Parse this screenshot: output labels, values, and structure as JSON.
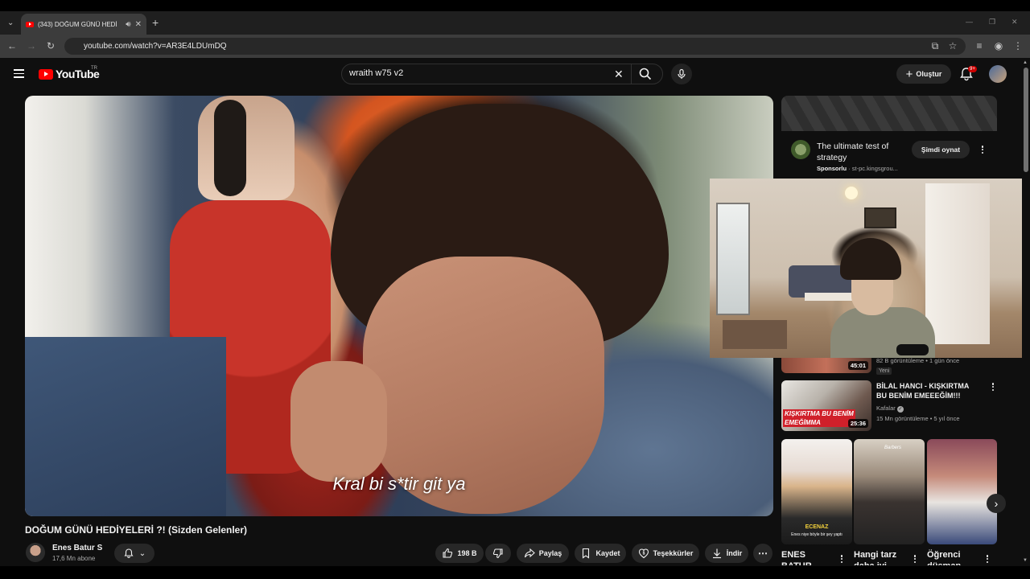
{
  "browser": {
    "tab_title": "(343) DOĞUM GÜNÜ HEDİ",
    "url": "youtube.com/watch?v=AR3E4LDUmDQ"
  },
  "header": {
    "logo_text": "YouTube",
    "country_code": "TR",
    "search_value": "wraith w75 v2",
    "create_label": "Oluştur",
    "notification_count": "9+"
  },
  "video": {
    "subtitle": "Kral bi s*tir git ya",
    "title": "DOĞUM GÜNÜ HEDİYELERİ ?! (Sizden Gelenler)",
    "channel_name": "Enes Batur S",
    "subscribers": "17,6 Mn abone",
    "likes": "198 B",
    "share_label": "Paylaş",
    "save_label": "Kaydet",
    "thanks_label": "Teşekkürler",
    "download_label": "İndir"
  },
  "sidebar": {
    "ad": {
      "title": "The ultimate test of strategy",
      "sponsor_label": "Sponsorlu",
      "sponsor_domain": "st-pc.kingsgrou...",
      "cta": "Şimdi oynat"
    },
    "recs": [
      {
        "duration": "45:01",
        "meta": "82 B görüntüleme • 1 gün önce",
        "badge": "Yeni"
      },
      {
        "title": "BİLAL HANCI - KIŞKIRTMA BU BENİM EMEEEĞİM!!!",
        "channel": "Kafalar",
        "meta": "15 Mn görüntüleme • 5 yıl önce",
        "duration": "25:36",
        "thumb_text": "KIŞKIRTMA BU BENİM EMEĞİMMA"
      }
    ],
    "shorts": [
      {
        "title": "ENES BATUR ECENAZA",
        "overlay": "ECENAZ",
        "caption": "Enes niye böyle bir şey yaptı"
      },
      {
        "title": "Hangi tarz daha iyi",
        "overlay": "Barbers"
      },
      {
        "title": "Öğrenci düşman",
        "overlay": ""
      }
    ]
  }
}
